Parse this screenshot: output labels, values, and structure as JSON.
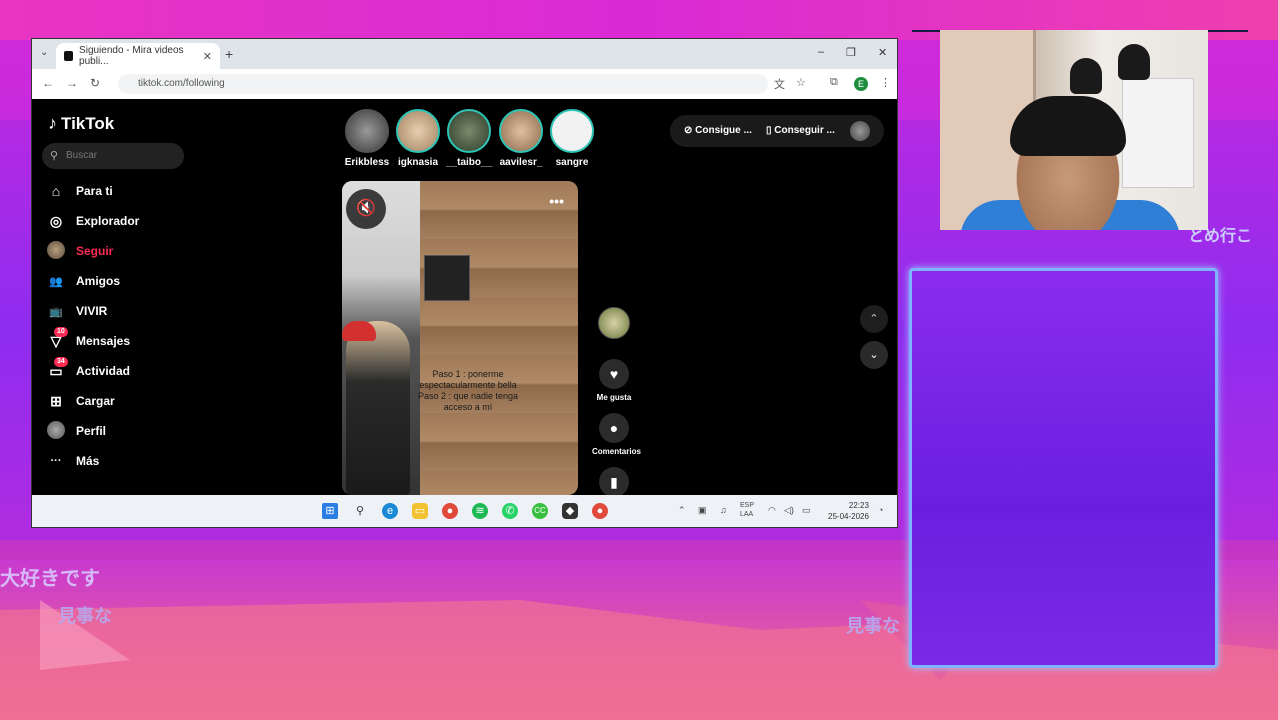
{
  "browser": {
    "tab_title": "Siguiendo - Mira videos publi...",
    "url": "tiktok.com/following",
    "profile_initial": "E",
    "window_controls": [
      "–",
      "❐",
      "✕"
    ]
  },
  "tiktok": {
    "logo": "TikTok",
    "search_placeholder": "Buscar",
    "sidebar": [
      {
        "label": "Para ti",
        "icon": "home-icon",
        "glyph": "⌂"
      },
      {
        "label": "Explorador",
        "icon": "compass-icon",
        "glyph": "◎"
      },
      {
        "label": "Seguir",
        "icon": "following-avatar-icon",
        "glyph": "",
        "active": true
      },
      {
        "label": "Amigos",
        "icon": "friends-icon",
        "glyph": "👥"
      },
      {
        "label": "VIVIR",
        "icon": "live-tv-icon",
        "glyph": "📺"
      },
      {
        "label": "Mensajes",
        "icon": "messages-icon",
        "glyph": "▽",
        "badge": "10"
      },
      {
        "label": "Actividad",
        "icon": "activity-icon",
        "glyph": "▭",
        "badge": "34"
      },
      {
        "label": "Cargar",
        "icon": "upload-icon",
        "glyph": "⊞"
      },
      {
        "label": "Perfil",
        "icon": "profile-avatar-icon",
        "glyph": ""
      },
      {
        "label": "Más",
        "icon": "more-dots-icon",
        "glyph": "···"
      }
    ],
    "stories": [
      {
        "name": "Erikbless",
        "color": "#6d6d6d"
      },
      {
        "name": "igknasia",
        "color": "#c8a888"
      },
      {
        "name": "__taibo__",
        "color": "#3a4a3a"
      },
      {
        "name": "aavilesr_",
        "color": "#c0a080"
      },
      {
        "name": "sangre",
        "color": "#f2f2f2"
      }
    ],
    "top_buttons": [
      "Consigue ...",
      "Conseguir ..."
    ],
    "video": {
      "overlay_text": "Paso 1 : ponerme espectacularmente bella Paso 2 : que nadie tenga acceso a mí",
      "more": "•••",
      "mute": "🔇"
    },
    "actions": {
      "like_label": "Me gusta",
      "comments_label": "Comentarios"
    }
  },
  "taskbar": {
    "lang": "ESP\nLAA",
    "time": "22:23",
    "date": "25-04-2026"
  },
  "stream": {
    "jp_text_1": "大好きです",
    "jp_text_2": "見事な",
    "jp_text_3": "見事な",
    "jp_text_4": "とめ行こ"
  },
  "colors": {
    "accent": "#fe2c55",
    "story_ring": "#2ec4b6",
    "panel_border": "#7fb2ff"
  }
}
